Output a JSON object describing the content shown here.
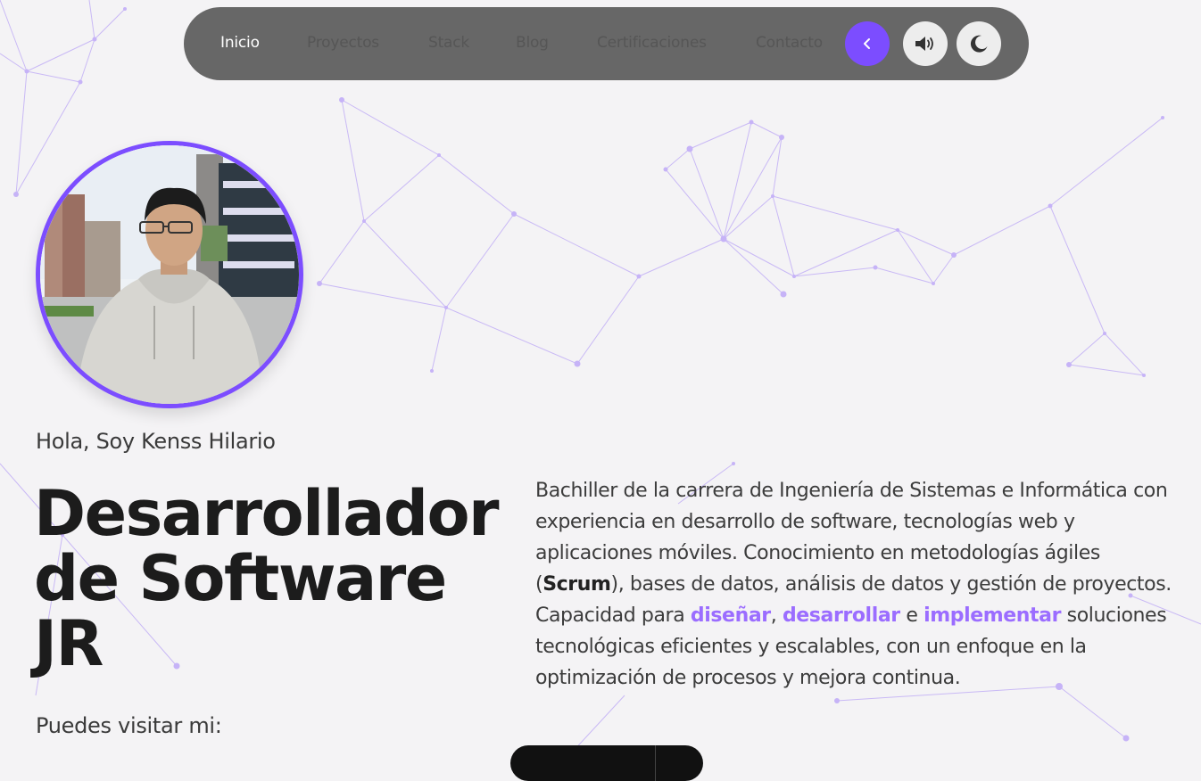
{
  "nav": {
    "items": [
      {
        "label": "Inicio",
        "active": true
      },
      {
        "label": "Proyectos",
        "active": false
      },
      {
        "label": "Stack",
        "active": false
      },
      {
        "label": "Blog",
        "active": false
      },
      {
        "label": "Certificaciones",
        "active": false
      },
      {
        "label": "Contacto",
        "active": false
      }
    ],
    "buttons": {
      "collapse_icon": "chevron-left-icon",
      "sound_icon": "speaker-icon",
      "theme_icon": "moon-icon"
    },
    "accent_color": "#7c4dff"
  },
  "hero": {
    "greeting": "Hola, Soy Kenss Hilario",
    "title_lines": [
      "Desarrollador",
      "de Software",
      "JR"
    ],
    "bio": {
      "part1": "Bachiller de la carrera de Ingeniería de Sistemas e Informática con experiencia en desarrollo de software, tecnologías web y aplicaciones móviles. Conocimiento en metodologías ágiles (",
      "scrum": "Scrum",
      "part2": "), bases de datos, análisis de datos y gestión de proyectos. Capacidad para ",
      "hl1": "diseñar",
      "sep1": ", ",
      "hl2": "desarrollar",
      "sep2": " e ",
      "hl3": "implementar",
      "part3": " soluciones tecnológicas eficientes y escalables, con un enfoque en la optimización de procesos y mejora continua."
    },
    "visit_label": "Puedes visitar mi:"
  },
  "colors": {
    "background": "#f4f3f5",
    "highlight": "#9b6dff"
  }
}
